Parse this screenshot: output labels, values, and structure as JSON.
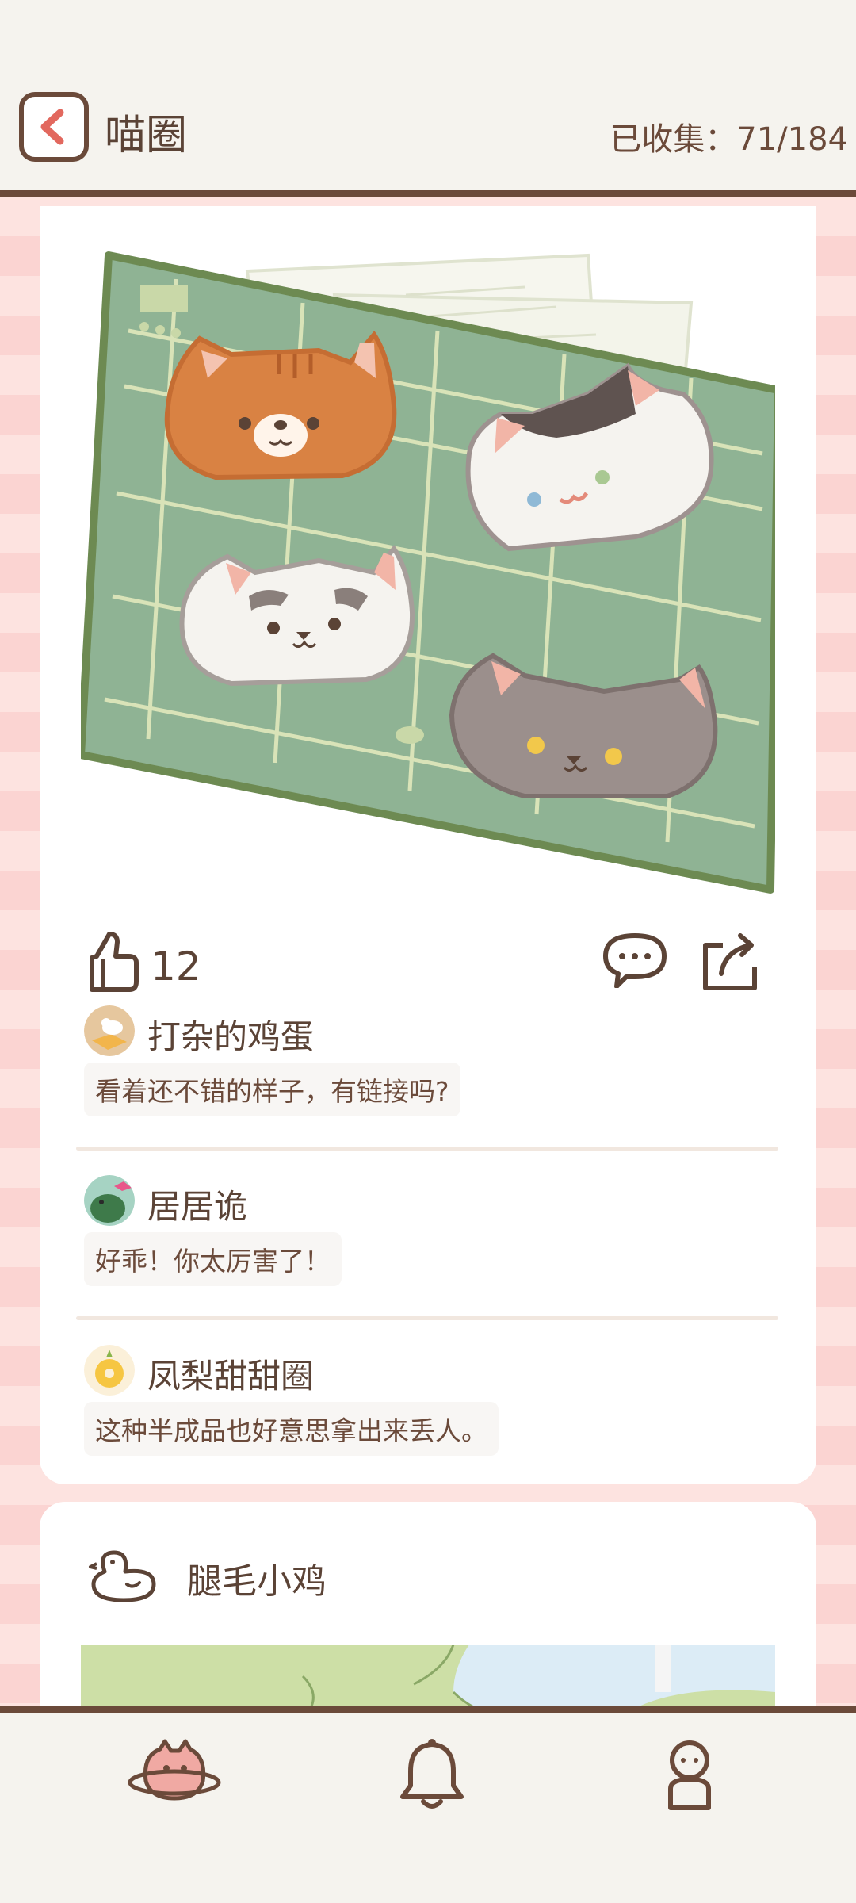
{
  "header": {
    "title": "喵圈",
    "collected": "已收集：71/184"
  },
  "post": {
    "likes": "12",
    "comments": [
      {
        "name": "打杂的鸡蛋",
        "text": "看着还不错的样子，有链接吗?"
      },
      {
        "name": "居居诡",
        "text": "好乖！你太厉害了！"
      },
      {
        "name": "凤梨甜甜圈",
        "text": "这种半成品也好意思拿出来丢人。"
      }
    ]
  },
  "next_post": {
    "author": "腿毛小鸡"
  },
  "nav": {
    "items": [
      "planet-icon",
      "bell-icon",
      "profile-icon"
    ]
  },
  "colors": {
    "accent_brown": "#6b4a3a",
    "stripe_pink": "#fbd4d2",
    "mat_green": "#8fb394"
  }
}
